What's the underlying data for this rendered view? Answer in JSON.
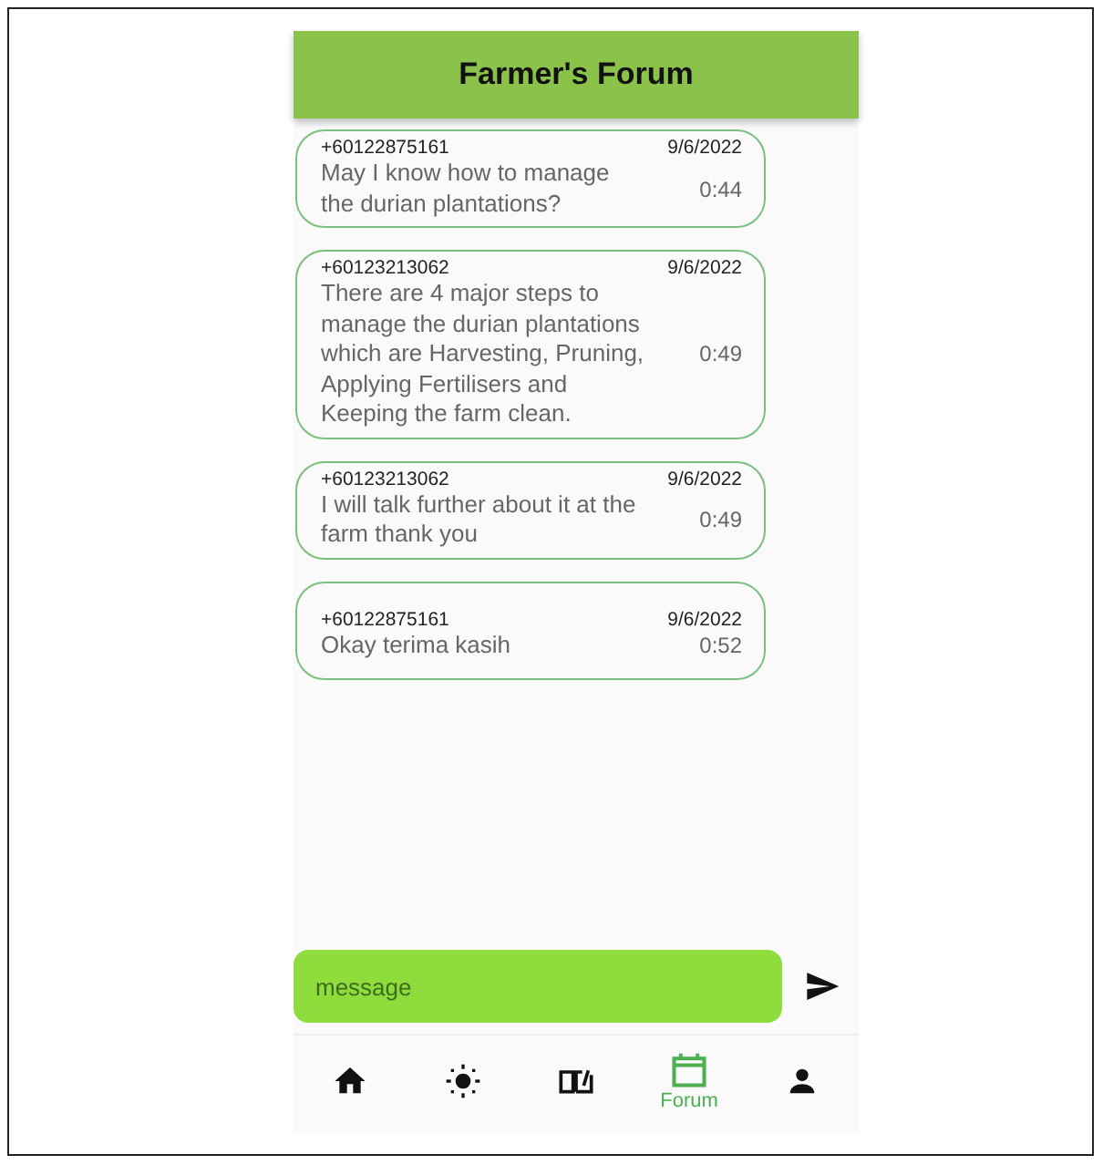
{
  "header": {
    "title": "Farmer's Forum"
  },
  "messages": [
    {
      "sender": "+60122875161",
      "date": "9/6/2022",
      "text": "May I know how to manage the durian plantations?",
      "time": "0:44"
    },
    {
      "sender": "+60123213062",
      "date": "9/6/2022",
      "text": "There are 4 major steps to manage the durian plantations which are Harvesting, Pruning, Applying Fertilisers and Keeping the farm clean.",
      "time": "0:49"
    },
    {
      "sender": "+60123213062",
      "date": "9/6/2022",
      "text": "I will talk further about it at the farm thank you",
      "time": "0:49"
    },
    {
      "sender": "+60122875161",
      "date": "9/6/2022",
      "text": "Okay terima kasih",
      "time": "0:52"
    }
  ],
  "composer": {
    "placeholder": "message"
  },
  "nav": [
    {
      "kind": "home",
      "selected": false
    },
    {
      "kind": "weather",
      "selected": false
    },
    {
      "kind": "guide",
      "selected": false
    },
    {
      "kind": "forum",
      "selected": true,
      "label": "Forum"
    },
    {
      "kind": "profile",
      "selected": false
    }
  ]
}
